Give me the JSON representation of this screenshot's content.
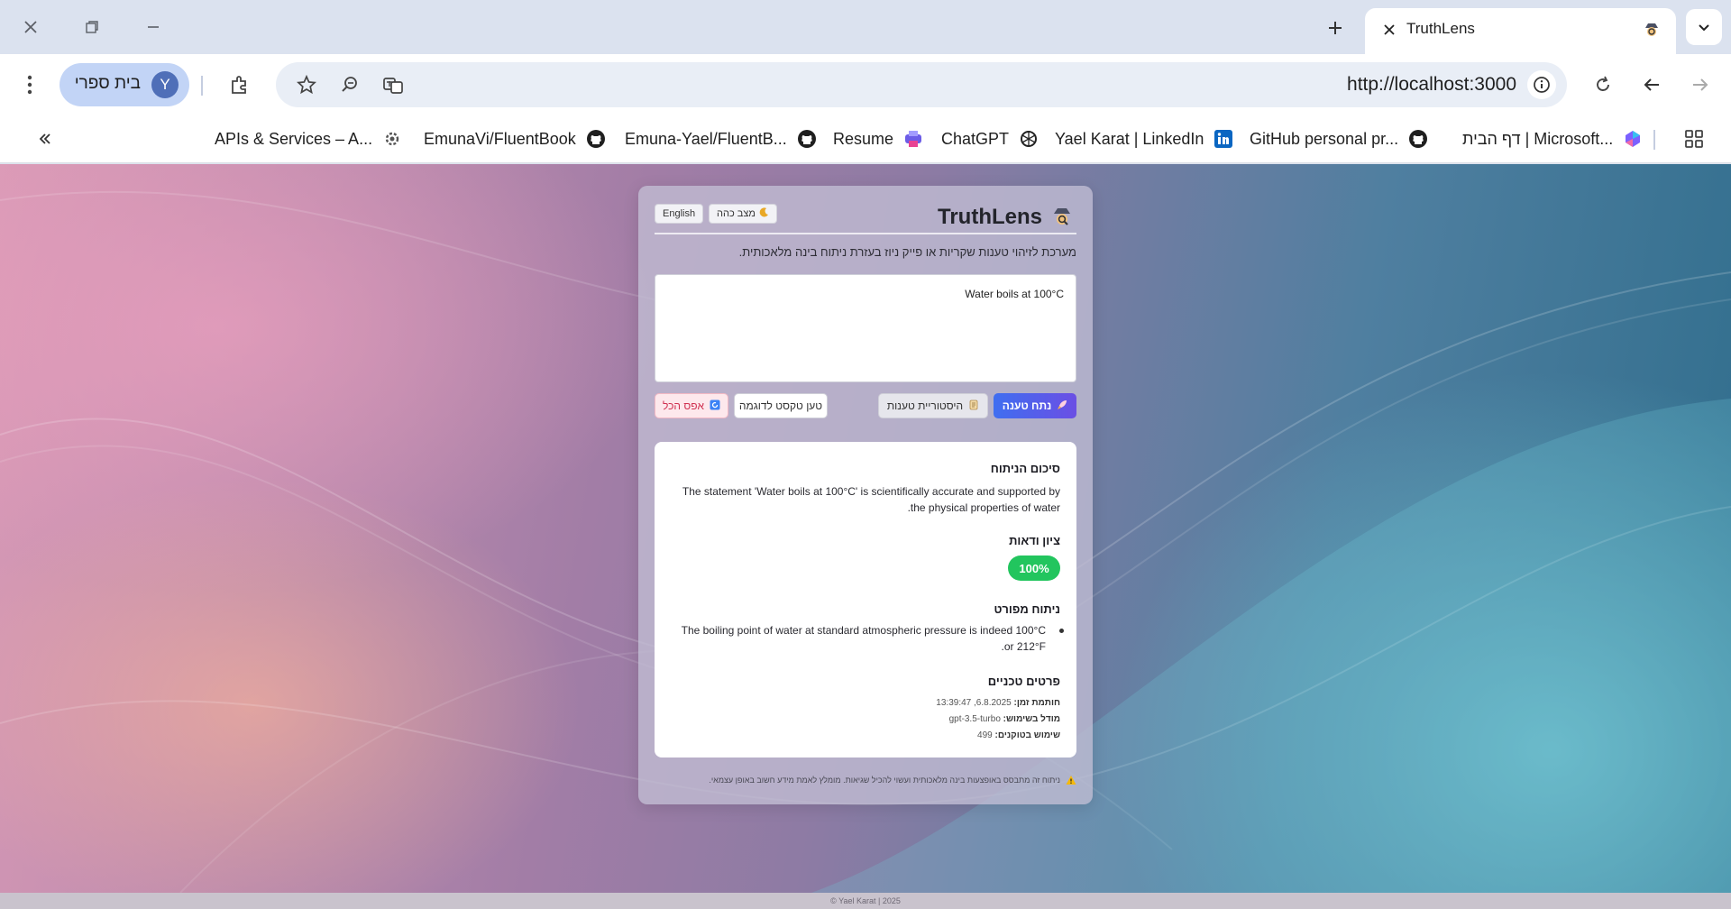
{
  "browser": {
    "tab_title": "TruthLens",
    "url": "http://localhost:3000",
    "profile_name": "בית ספרי",
    "profile_initial": "Y"
  },
  "bookmarks": [
    {
      "label": "דף הבית | Microsoft...",
      "icon": "copilot-icon"
    },
    {
      "label": "GitHub personal pr...",
      "icon": "github-icon"
    },
    {
      "label": "Yael Karat | LinkedIn",
      "icon": "linkedin-icon"
    },
    {
      "label": "ChatGPT",
      "icon": "openai-icon"
    },
    {
      "label": "Resume",
      "icon": "print-icon"
    },
    {
      "label": "Emuna-Yael/FluentB...",
      "icon": "github-icon"
    },
    {
      "label": "EmunaVi/FluentBook",
      "icon": "github-icon"
    },
    {
      "label": "APIs & Services – A...",
      "icon": "gear-cloud-icon"
    }
  ],
  "app": {
    "title": "TruthLens",
    "language_button": "English",
    "dark_mode_button": "מצב כהה",
    "subtitle": "מערכת לזיהוי טענות שקריות או פייק ניוז בעזרת ניתוח בינה מלאכותית.",
    "claim_value": "Water boils at 100°C",
    "analyze_button": "נתח טענה",
    "history_button": "היסטוריית טענות",
    "sample_button": "טען טקסט לדוגמה",
    "clear_button": "אפס הכל"
  },
  "result": {
    "summary_heading": "סיכום הניתוח",
    "summary_text": "The statement 'Water boils at 100°C' is scientifically accurate and supported by the physical properties of water.",
    "confidence_heading": "ציון ודאות",
    "confidence_value": "100%",
    "confidence_color": "#22c55e",
    "detail_heading": "ניתוח מפורט",
    "detail_items": [
      "The boiling point of water at standard atmospheric pressure is indeed 100°C or 212°F."
    ],
    "tech_heading": "פרטים טכניים",
    "timestamp_label": "חותמת זמן:",
    "timestamp_value": "6.8.2025, 13:39:47",
    "model_label": "מודל בשימוש:",
    "model_value": "gpt-3.5-turbo",
    "tokens_label": "שימוש בטוקנים:",
    "tokens_value": "499"
  },
  "disclaimer": "ניתוח זה מתבסס באופצעות בינה מלאכותית ועשוי להכיל שגיאות. מומלץ לאמת מידע חשוב באופן עצמאי.",
  "footer": "© Yael Karat | 2025",
  "colors": {
    "accent_gradient_start": "#3f6ef0",
    "accent_gradient_end": "#6b4fe4",
    "clear_button_text": "#d03050"
  }
}
